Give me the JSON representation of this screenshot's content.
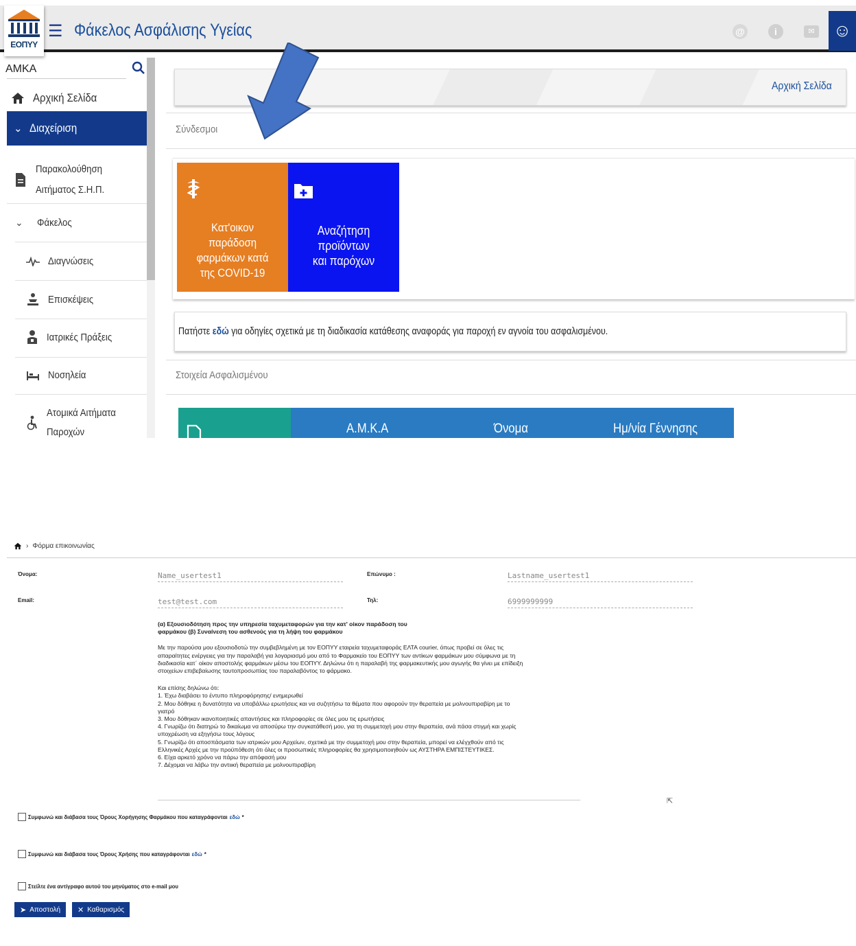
{
  "app": {
    "logo_text": "ΕΟΠΥΥ",
    "title": "Φάκελος Ασφάλισης Υγείας",
    "accent": "#133a8a"
  },
  "sidebar": {
    "search_label": "ΑΜΚΑ",
    "home": "Αρχική Σελίδα",
    "active": "Διαχείριση",
    "items": [
      {
        "label": "Παρακολούθηση",
        "label2": "Αιτήματος Σ.Η.Π.",
        "icon": "document-icon"
      },
      {
        "label": "Φάκελος",
        "icon": "chevron-down-icon"
      },
      {
        "label": "Διαγνώσεις",
        "icon": "pulse-icon"
      },
      {
        "label": "Επισκέψεις",
        "icon": "visit-icon"
      },
      {
        "label": "Ιατρικές Πράξεις",
        "icon": "doctor-icon"
      },
      {
        "label": "Νοσηλεία",
        "icon": "bed-icon"
      },
      {
        "label": "Ατομικά Αιτήματα",
        "label2": "Παροχών",
        "icon": "wheelchair-icon"
      }
    ]
  },
  "main": {
    "breadcrumb": "Αρχική Σελίδα",
    "links_label": "Σύνδεσμοι",
    "tiles": [
      {
        "lines": [
          "Κατ'οικον",
          "παράδοση",
          "φαρμάκων κατά",
          "της COVID-19"
        ],
        "color": "#e67e22"
      },
      {
        "lines": [
          "Αναζήτηση",
          "προϊόντων",
          "και παρόχων"
        ],
        "color": "#0a14f0"
      }
    ],
    "info": {
      "prefix": "Πατήστε ",
      "link": "εδώ",
      "suffix": " για οδηγίες σχετικά με τη διαδικασία κατάθεσης αναφοράς για παροχή εν αγνοία του ασφαλισμένου."
    },
    "insured_label": "Στοιχεία Ασφαλισμένου",
    "table_headers": [
      "Α.Μ.Κ.Α",
      "Όνομα",
      "Ημ/νία Γέννησης"
    ]
  },
  "form": {
    "breadcrumb": "Φόρμα επικοινωνίας",
    "first_name_label": "Όνομα:",
    "first_name_value": "Name_usertest1",
    "last_name_label": "Επώνυμο :",
    "last_name_value": "Lastname_usertest1",
    "email_label": "Email:",
    "email_value": "test@test.com",
    "phone_label": "Τηλ:",
    "phone_value": "6999999999",
    "consent_title": "(α) Εξουσιοδότηση προς την υπηρεσία ταχυμεταφορών για την κατ' οίκον παράδοση του\nφαρμάκου (β) Συναίνεση του ασθενούς για τη λήψη του φαρμάκου",
    "consent_paragraph": "Με την παρούσα μου εξουσιοδοτώ την συμβεβλημένη με τον ΕΟΠΥΥ εταιρεία ταχυμεταφοράς ΕΛΤΑ courier, όπως προβεί σε όλες τις\nαπαραίτητες ενέργειες για την παραλαβή για λογαριασμό μου από το Φαρμακείο του ΕΟΠΥΥ των αντίκων φαρμάκων μου σύμφωνα με τη\nδιαδικασία κατ΄ οίκον αποστολής φαρμάκων μέσω του ΕΟΠΥΥ. Δηλώνω ότι η παραλαβή της φαρμακευτικής μου αγωγής θα γίνει με επίδειξη\nστοιχείων επιβεβαίωσης ταυτοπροσωπίας του παραλαβόντος το φάρμακο.",
    "declare_intro": "Και επίσης δηλώνω ότι:",
    "declarations": [
      "1.   Έχω διαβάσει το έντυπο πληροφόρησης/ ενημερωθεί",
      "2.   Μου δόθηκε η δυνατότητα να υποβάλλω ερωτήσεις και να συζητήσω τα θέματα που αφορούν την θεραπεία με μολνουπιραβίρη με το\nγιατρό",
      "3.   Μου δόθηκαν ικανοποιητικές απαντήσεις και πληροφορίες σε όλες μου τις ερωτήσεις",
      "4.   Γνωρίζω ότι διατηρώ το δικαίωμα να αποσύρω την συγκατάθεσή μου, για τη συμμετοχή μου στην θεραπεία, ανά πάσα στιγμή και χωρίς\nυποχρέωση να εξηγήσω τους λόγους",
      "5.   Γνωρίζω ότι  αποσπάσματα των ιατρικών μου Αρχείων, σχετικά με την συμμετοχή μου στην θεραπεία,  μπορεί να ελέγχθούν από τις\nΕλληνικές Αρχές με την προϋπόθεση ότι όλες οι προσωπικές πληροφορίες θα χρησιμοποιηθούν ως ΑΥΣΤΗΡΑ ΕΜΠΙΣΤΕΥΤΙΚΕΣ.",
      "6.   Είχα αρκετό χρόνο να πάρω την απόφασή μου",
      "7.   Δέχομαι να λάβω την αντιική θεραπεία με μολνουπιραβίρη"
    ],
    "check1_label": "Συμφωνώ και διάβασα τους Όρους Χορήγησης Φαρμάκου που καταγράφονται",
    "check1_link": "εδώ",
    "check2_label": "Συμφωνώ και διάβασα τους Όρους Χρήσης που καταγράφονται",
    "check2_link": "εδώ",
    "required_mark": "*",
    "check3_label": "Στείλτε ένα αντίγραφο αυτού του μηνύματος στο e-mail μου",
    "submit_label": "Αποστολή",
    "clear_label": "Καθαρισμός"
  }
}
